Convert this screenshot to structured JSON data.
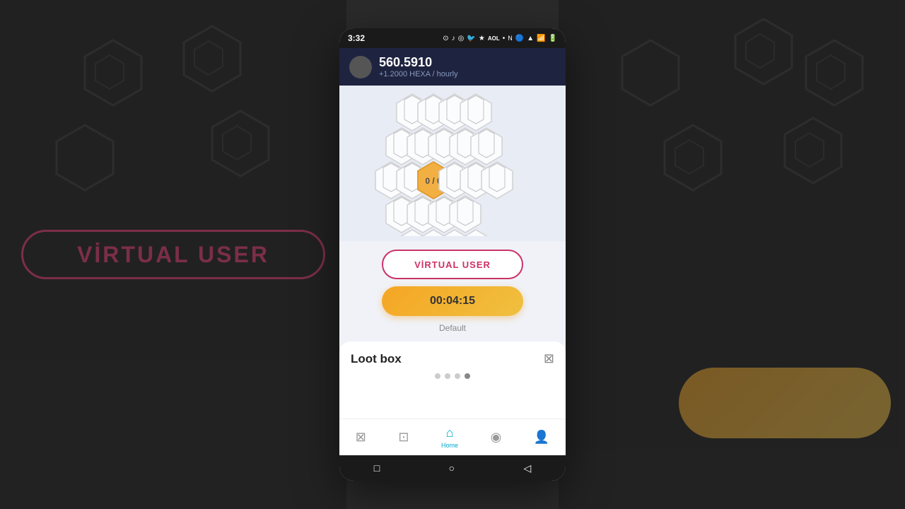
{
  "status_bar": {
    "time": "3:32",
    "icons": [
      "●",
      "♪",
      "⊙",
      "🐦",
      "★",
      "AOL",
      "•",
      "N",
      "🔵",
      "▲",
      "📶",
      "🔋"
    ]
  },
  "header": {
    "balance": "560.5910",
    "rate": "+1.2000 HEXA / hourly"
  },
  "hex_grid": {
    "center_label": "0 / 0"
  },
  "buttons": {
    "virtual_user": "VİRTUAL USER",
    "timer": "00:04:15",
    "default_text": "Default"
  },
  "loot_box": {
    "title": "Loot box",
    "icon": "🎁"
  },
  "bottom_nav": {
    "items": [
      {
        "icon": "⊠",
        "label": "",
        "active": false
      },
      {
        "icon": "🏠",
        "label": "",
        "active": false
      },
      {
        "icon": "⌂",
        "label": "Home",
        "active": true
      },
      {
        "icon": "◉",
        "label": "",
        "active": false
      },
      {
        "icon": "👤",
        "label": "",
        "active": false
      }
    ]
  },
  "system_nav": {
    "square": "□",
    "circle": "○",
    "back": "◁"
  }
}
